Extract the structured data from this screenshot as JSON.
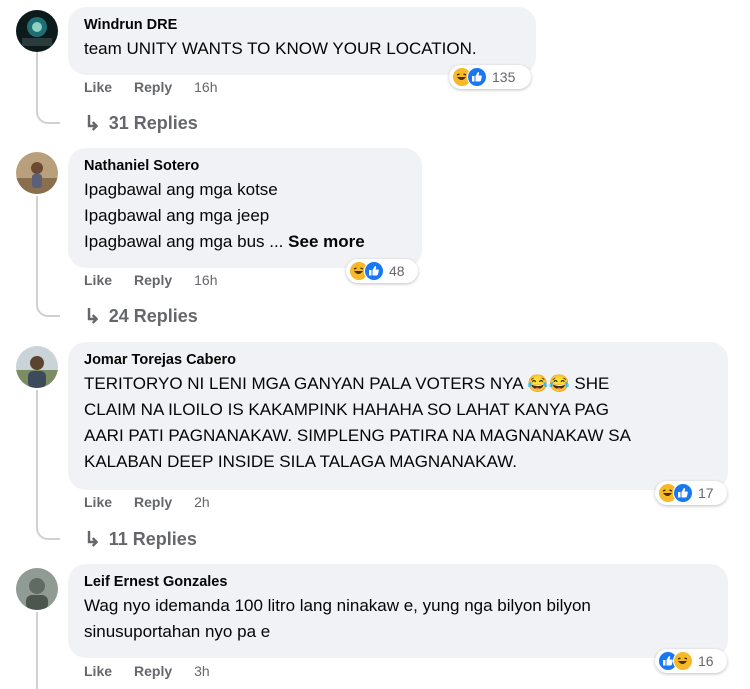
{
  "colors": {
    "bubble_bg": "#f0f2f5",
    "meta_text": "#65676b",
    "like_blue": "#1877f2",
    "haha_yellow": "#f7b928"
  },
  "icons": {
    "reply_arrow": "reply-arrow-icon",
    "haha": "haha-reaction-icon",
    "like": "like-reaction-icon"
  },
  "comments": [
    {
      "author": "Windrun DRE",
      "lines": [
        "team UNITY WANTS TO KNOW YOUR LOCATION."
      ],
      "like_label": "Like",
      "reply_label": "Reply",
      "time": "16h",
      "reaction_count": "135",
      "replies_label": "31 Replies"
    },
    {
      "author": "Nathaniel Sotero",
      "lines": [
        "Ipagbawal ang mga kotse",
        "Ipagbawal ang mga jeep",
        "Ipagbawal ang mga bus ..."
      ],
      "see_more": "See more",
      "like_label": "Like",
      "reply_label": "Reply",
      "time": "16h",
      "reaction_count": "48",
      "replies_label": "24 Replies"
    },
    {
      "author": "Jomar Torejas Cabero",
      "lines": [
        "TERITORYO NI LENI MGA GANYAN PALA VOTERS NYA 😂😂 SHE",
        "CLAIM NA ILOILO IS KAKAMPINK HAHAHA SO LAHAT KANYA PAG",
        "AARI PATI PAGNANAKAW. SIMPLENG PATIRA NA MAGNANAKAW SA",
        "KALABAN DEEP INSIDE SILA TALAGA MAGNANAKAW."
      ],
      "like_label": "Like",
      "reply_label": "Reply",
      "time": "2h",
      "reaction_count": "17",
      "replies_label": "11 Replies"
    },
    {
      "author": "Leif Ernest Gonzales",
      "lines": [
        "Wag nyo idemanda 100 litro lang ninakaw e, yung nga bilyon bilyon",
        "sinusuportahan nyo pa e"
      ],
      "like_label": "Like",
      "reply_label": "Reply",
      "time": "3h",
      "reaction_count": "16"
    }
  ]
}
